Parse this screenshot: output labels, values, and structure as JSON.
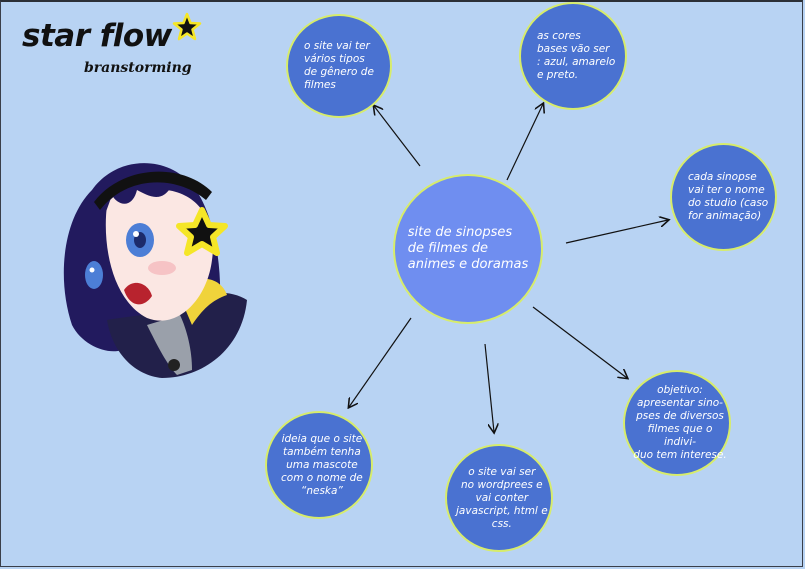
{
  "logo": {
    "title": "star flow",
    "subtitle": "branstorming"
  },
  "center": {
    "text": "site de sinopses\n  de filmes de\n animes e doramas"
  },
  "nodes": [
    {
      "id": "genres",
      "text": "o site vai ter\nvários tipos\nde gênero de\nfilmes"
    },
    {
      "id": "colors",
      "text": "as cores\nbases vão ser\n: azul, amarelo\ne preto."
    },
    {
      "id": "studio",
      "text": "cada sinopse\nvai ter o nome\ndo  studio (caso\nfor animação)"
    },
    {
      "id": "objective",
      "text": "objetivo:\napresentar  sino-\npses de diversos\nfilmes que o indivi-\nduo tem interese."
    },
    {
      "id": "wordpress",
      "text": "o site vai ser\nno wordprees e\nvai conter\njavascript, html e\ncss."
    },
    {
      "id": "mascot",
      "text": "ideia que o site\ntambém tenha\numa mascote\ncom o nome de\n“neska”"
    }
  ],
  "colors": {
    "background": "#b8d3f3",
    "node_fill": "#4a72d1",
    "center_fill": "#6f8ef0",
    "node_border": "#d7ec6b",
    "star": "#f5e627",
    "hair": "#221a5e"
  },
  "icons": [
    "star-icon",
    "mascot-neska"
  ]
}
